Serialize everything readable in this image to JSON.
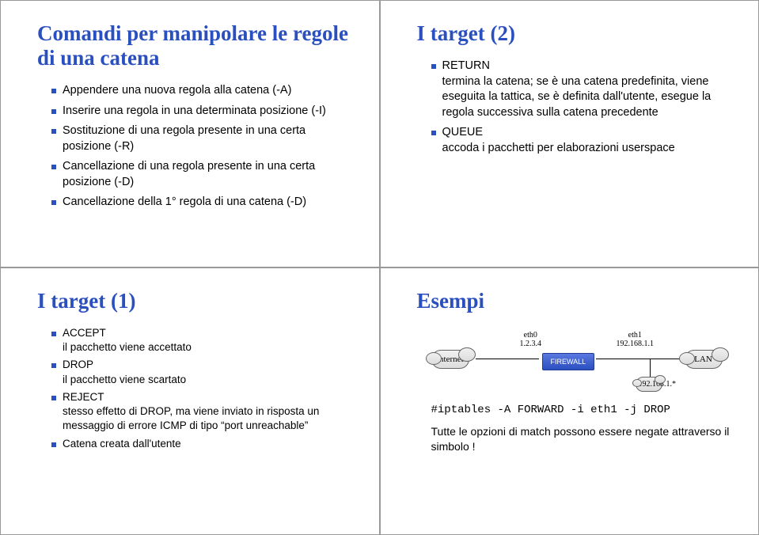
{
  "slides": {
    "tl": {
      "title": "Comandi per manipolare le regole di una catena",
      "items": [
        {
          "term": "",
          "desc": "Appendere una nuova regola alla catena (-A)"
        },
        {
          "term": "",
          "desc": "Inserire una regola in una determinata posizione (-I)"
        },
        {
          "term": "",
          "desc": "Sostituzione di una regola presente in una certa posizione (-R)"
        },
        {
          "term": "",
          "desc": "Cancellazione di una regola presente in una certa posizione (-D)"
        },
        {
          "term": "",
          "desc": "Cancellazione della 1° regola di una catena (-D)"
        }
      ]
    },
    "tr": {
      "title": "I target (2)",
      "items": [
        {
          "term": "RETURN",
          "desc": "termina la catena; se è una catena predefinita, viene eseguita la tattica, se è definita dall'utente, esegue la regola successiva sulla catena precedente"
        },
        {
          "term": "QUEUE",
          "desc": "accoda i pacchetti per elaborazioni userspace"
        }
      ]
    },
    "bl": {
      "title": "I target (1)",
      "items": [
        {
          "term": "ACCEPT",
          "desc": "il pacchetto viene accettato"
        },
        {
          "term": "DROP",
          "desc": "il pacchetto viene scartato"
        },
        {
          "term": "REJECT",
          "desc": "stesso effetto di DROP, ma viene inviato in risposta un messaggio di errore ICMP di tipo “port unreachable”"
        },
        {
          "term": "",
          "desc": "Catena creata dall'utente"
        }
      ]
    },
    "br": {
      "title": "Esempi",
      "diagram": {
        "internet": "Internet",
        "lan": "LAN",
        "firewall": "FIREWALL",
        "eth0": "eth0",
        "eth0ip": "1.2.3.4",
        "eth1": "eth1",
        "eth1ip": "192.168.1.1",
        "subnet": "192.168.1.*"
      },
      "cmd": "#iptables -A FORWARD -i eth1 -j DROP",
      "caption": "Tutte le opzioni di match possono essere negate attraverso il simbolo !"
    }
  }
}
